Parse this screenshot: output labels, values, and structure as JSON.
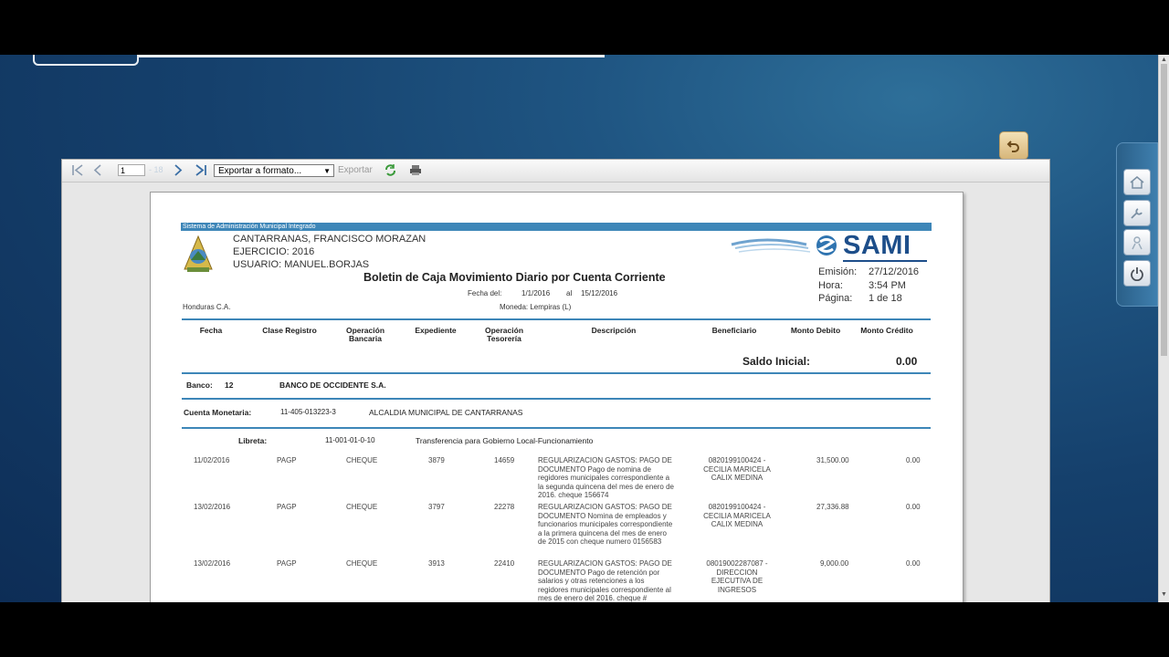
{
  "toolbar": {
    "page_value": "1",
    "page_total": "18",
    "export_placeholder": "Exportar a formato...",
    "export_label": "Exportar"
  },
  "report": {
    "system_name": "Sistema de Administración Municipal Integrado",
    "municipality": "CANTARRANAS, FRANCISCO MORAZAN",
    "ejercicio": "EJERCICIO: 2016",
    "usuario": "USUARIO: MANUEL.BORJAS",
    "title": "Boletin de Caja Movimiento Diario por Cuenta Corriente",
    "fecha_del_label": "Fecha del:",
    "fecha_del": "1/1/2016",
    "al_label": "al",
    "fecha_al": "15/12/2016",
    "country": "Honduras C.A.",
    "moneda": "Moneda: Lempiras (L)",
    "logo_text": "SAMI",
    "emision_label": "Emisión:",
    "emision": "27/12/2016",
    "hora_label": "Hora:",
    "hora": "3:54 PM",
    "pagina_label": "Página:",
    "pagina": "1 de 18",
    "columns": [
      "Fecha",
      "Clase Registro",
      "Operación Bancaria",
      "Expediente",
      "Operación Tesorería",
      "Descripción",
      "Beneficiario",
      "Monto Debito",
      "Monto Crédito"
    ],
    "saldo_label": "Saldo Inicial:",
    "saldo_value": "0.00",
    "banco_label": "Banco:",
    "banco_code": "12",
    "banco_name": "BANCO DE OCCIDENTE S.A.",
    "cuenta_label": "Cuenta Monetaria:",
    "cuenta_code": "11-405-013223-3",
    "cuenta_name": "ALCALDIA MUNICIPAL DE CANTARRANAS",
    "libreta_label": "Libreta:",
    "libreta_code": "11-001-01-0-10",
    "libreta_name": "Transferencia para Gobierno Local-Funcionamiento",
    "rows": [
      {
        "fecha": "11/02/2016",
        "clase": "PAGP",
        "operacion": "CHEQUE",
        "expediente": "3879",
        "tesoreria": "14659",
        "descripcion": "REGULARIZACION GASTOS: PAGO DE DOCUMENTO Pago de nomina de regidores municipales correspondiente a la segunda quincena del mes de enero de 2016. cheque 156674",
        "beneficiario": "0820199100424 - CECILIA MARICELA CALIX MEDINA",
        "debito": "31,500.00",
        "credito": "0.00"
      },
      {
        "fecha": "13/02/2016",
        "clase": "PAGP",
        "operacion": "CHEQUE",
        "expediente": "3797",
        "tesoreria": "22278",
        "descripcion": "REGULARIZACION GASTOS: PAGO DE DOCUMENTO Nomina de empleados y funcionarios municipales correspondiente a la primera quincena del mes de enero de 2015 con cheque numero 0156583",
        "beneficiario": "0820199100424 - CECILIA MARICELA CALIX MEDINA",
        "debito": "27,336.88",
        "credito": "0.00"
      },
      {
        "fecha": "13/02/2016",
        "clase": "PAGP",
        "operacion": "CHEQUE",
        "expediente": "3913",
        "tesoreria": "22410",
        "descripcion": "REGULARIZACION GASTOS: PAGO DE DOCUMENTO Pago de retención por salarios y otras retenciones a los regidores municipales correspondiente al mes de enero del 2016. cheque #",
        "beneficiario": "08019002287087 - DIRECCION EJECUTIVA DE INGRESOS",
        "debito": "9,000.00",
        "credito": "0.00"
      }
    ]
  },
  "icons": [
    "first-page-icon",
    "prev-page-icon",
    "next-page-icon",
    "last-page-icon",
    "refresh-icon",
    "print-icon",
    "undo-icon",
    "home-icon",
    "wrench-icon",
    "person-icon",
    "power-icon",
    "honduras-coat-of-arms-icon",
    "sami-logo-icon"
  ]
}
